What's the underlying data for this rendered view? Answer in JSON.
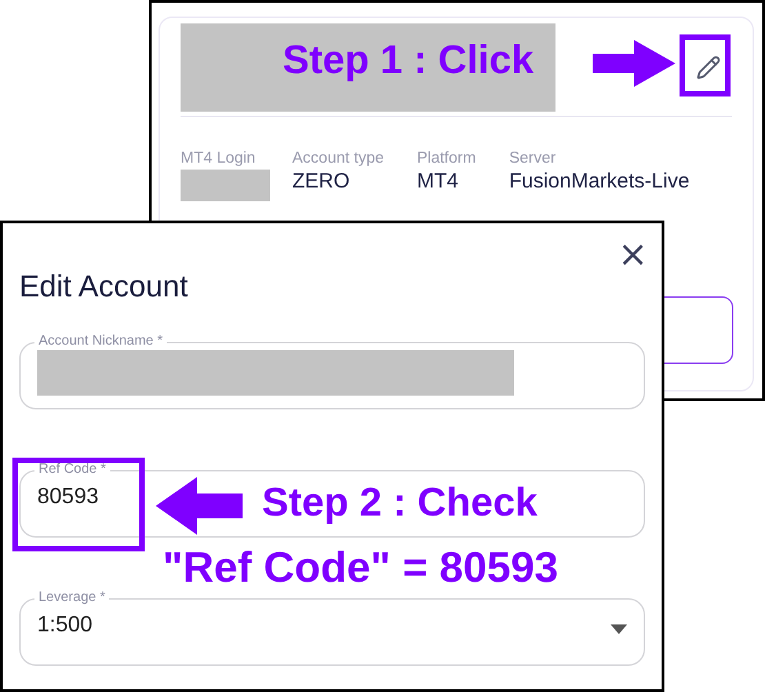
{
  "account_card": {
    "details": [
      {
        "label": "MT4 Login",
        "redacted": true
      },
      {
        "label": "Account type",
        "value": "ZERO",
        "redacted": false
      },
      {
        "label": "Platform",
        "value": "MT4",
        "redacted": false
      },
      {
        "label": "Server",
        "value": "FusionMarkets-Live",
        "redacted": false
      }
    ]
  },
  "dialog": {
    "title": "Edit Account",
    "close": "×",
    "fields": [
      {
        "label": "Account Nickname *",
        "redacted": true,
        "kind": "text"
      },
      {
        "label": "Ref Code *",
        "value": "80593",
        "redacted": false,
        "kind": "text"
      },
      {
        "label": "Leverage *",
        "value": "1:500",
        "redacted": false,
        "kind": "select"
      }
    ]
  },
  "annotations": {
    "step1": "Step 1 : Click",
    "step2": "Step 2 : Check",
    "result": "\"Ref Code\" = 80593"
  }
}
